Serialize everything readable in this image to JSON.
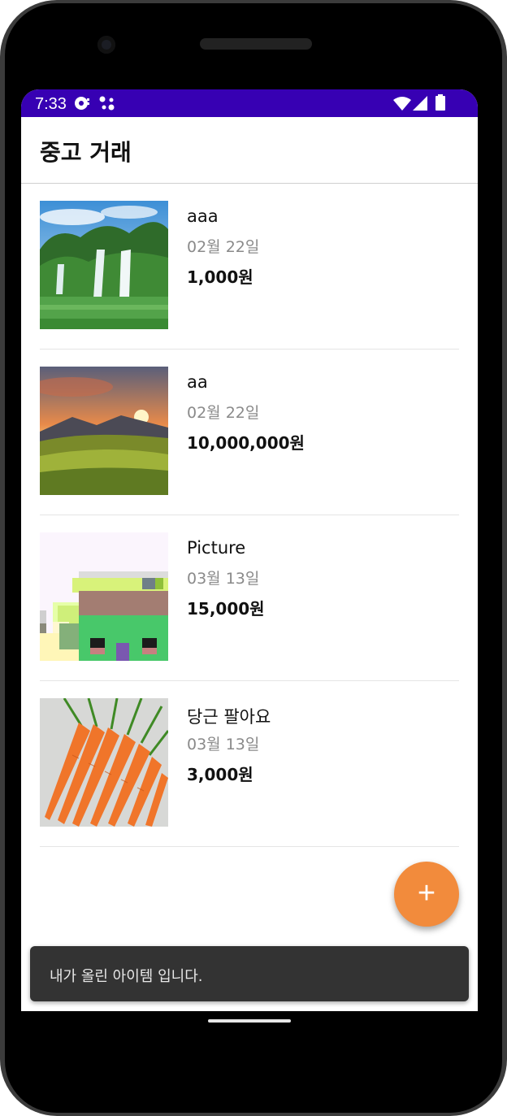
{
  "status_bar": {
    "time": "7:33",
    "left_icons": [
      "media-notification-icon",
      "assistant-dots-icon"
    ],
    "right_icons": [
      "wifi-icon",
      "cellular-signal-icon",
      "battery-icon"
    ],
    "background_color": "#3700b3"
  },
  "app_bar": {
    "title": "중고 거래"
  },
  "items": [
    {
      "title": "aaa",
      "date": "02월 22일",
      "price": "1,000원",
      "image": "waterfall-landscape-image"
    },
    {
      "title": "aa",
      "date": "02월 22일",
      "price": "10,000,000원",
      "image": "sunset-mountain-image"
    },
    {
      "title": "Picture",
      "date": "03월 13일",
      "price": "15,000원",
      "image": "pixel-art-image"
    },
    {
      "title": "당근 팔아요",
      "date": "03월 13일",
      "price": "3,000원",
      "image": "carrots-image"
    }
  ],
  "fab": {
    "icon": "plus-icon",
    "symbol": "+",
    "color": "#f28b3c"
  },
  "snackbar": {
    "text": "내가 올린 아이템 입니다."
  }
}
